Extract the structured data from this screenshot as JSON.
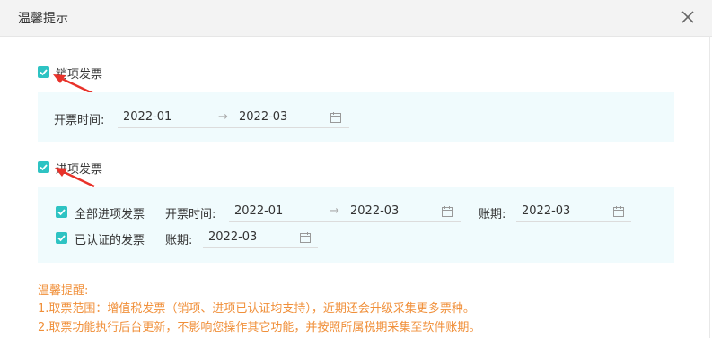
{
  "dialog": {
    "title": "温馨提示",
    "close_icon": "close-icon"
  },
  "sales": {
    "checkbox_label": "销项发票",
    "checked": true,
    "invoice_time_label": "开票时间:",
    "start": "2022-01",
    "end": "2022-03",
    "arrow": "→"
  },
  "purchase": {
    "checkbox_label": "进项发票",
    "checked": true,
    "all": {
      "label": "全部进项发票",
      "checked": true,
      "invoice_time_label": "开票时间:",
      "start": "2022-01",
      "end": "2022-03",
      "arrow": "→",
      "period_label": "账期:",
      "period": "2022-03"
    },
    "certified": {
      "label": "已认证的发票",
      "checked": true,
      "period_label": "账期:",
      "period": "2022-03"
    }
  },
  "notes": {
    "heading": "温馨提醒:",
    "line1": "1.取票范围：增值税发票（销项、进项已认证均支持），近期还会升级采集更多票种。",
    "line2": "2.取票功能执行后台更新，不影响您操作其它功能，并按照所属税期采集至软件账期。"
  },
  "colors": {
    "accent": "#2ec3c3",
    "note": "#f08f39",
    "annotation": "#e8322a",
    "panel": "#f0fbfd"
  }
}
